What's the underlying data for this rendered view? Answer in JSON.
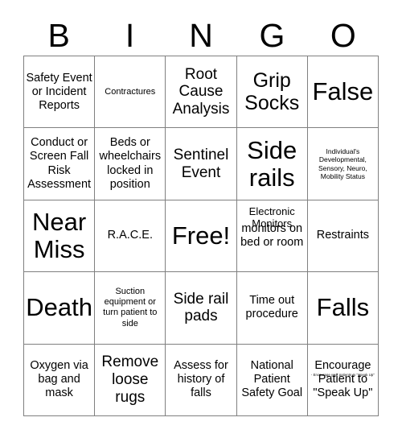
{
  "header": {
    "letters": [
      "B",
      "I",
      "N",
      "G",
      "O"
    ]
  },
  "grid": {
    "rows": [
      [
        {
          "text": "Safety Event or Incident Reports",
          "size": "fs-md"
        },
        {
          "text": "Contractures",
          "size": "fs-sm"
        },
        {
          "text": "Root Cause Analysis",
          "size": "fs-lg"
        },
        {
          "text": "Grip Socks",
          "size": "fs-xl"
        },
        {
          "text": "False",
          "size": "fs-xxl"
        }
      ],
      [
        {
          "text": "Conduct or Screen Fall Risk Assessment",
          "size": "fs-md"
        },
        {
          "text": "Beds or wheelchairs locked in position",
          "size": "fs-md"
        },
        {
          "text": "Sentinel Event",
          "size": "fs-lg"
        },
        {
          "text": "Side rails",
          "size": "fs-xxl"
        },
        {
          "text": "Individual's Developmental, Sensory, Neuro, Mobility Status",
          "size": "fs-xs"
        }
      ],
      [
        {
          "text": "Near Miss",
          "size": "fs-xxl"
        },
        {
          "text": "R.A.C.E.",
          "size": "fs-md"
        },
        {
          "text": "Free!",
          "size": "fs-xxl"
        },
        {
          "text": "monitors on bed or room",
          "size": "fs-md",
          "overlay": "Electronic Monitors",
          "overlay_class": "overlay-monitors"
        },
        {
          "text": "Restraints",
          "size": "fs-md"
        }
      ],
      [
        {
          "text": "Death",
          "size": "fs-xxl"
        },
        {
          "text": "Suction equipment or turn patient to side",
          "size": "fs-sm"
        },
        {
          "text": "Side rail pads",
          "size": "fs-lg"
        },
        {
          "text": "Time out procedure",
          "size": "fs-md"
        },
        {
          "text": "Falls",
          "size": "fs-xxl"
        }
      ],
      [
        {
          "text": "Oxygen via bag and mask",
          "size": "fs-md"
        },
        {
          "text": "Remove loose rugs",
          "size": "fs-lg"
        },
        {
          "text": "Assess for history of falls",
          "size": "fs-md"
        },
        {
          "text": "National Patient Safety Goal",
          "size": "fs-md"
        },
        {
          "text": "Encourage Patient to \"Speak Up\"",
          "size": "fs-md",
          "overlay": "-  Encourage your patients to \"Speak Up\"",
          "overlay_class": "overlay-speak"
        }
      ]
    ]
  },
  "colors": {
    "text": "#000000",
    "border": "#808080",
    "background": "#ffffff"
  }
}
